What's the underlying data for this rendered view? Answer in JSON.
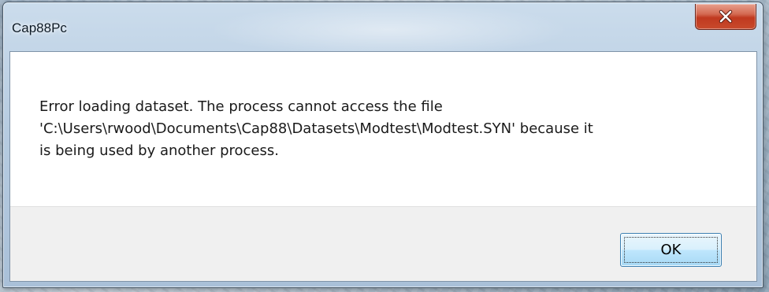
{
  "window": {
    "title": "Cap88Pc"
  },
  "title_bar": {
    "close_icon": "close-icon"
  },
  "message": {
    "text": "Error loading dataset. The process cannot access the file\n'C:\\Users\\rwood\\Documents\\Cap88\\Datasets\\Modtest\\Modtest.SYN' because it\nis being used by another process."
  },
  "buttons": {
    "ok_label": "OK"
  },
  "colors": {
    "close_button": "#c84a2c",
    "ok_button_border": "#3c7fb1",
    "button_bar": "#f0f0f0"
  }
}
